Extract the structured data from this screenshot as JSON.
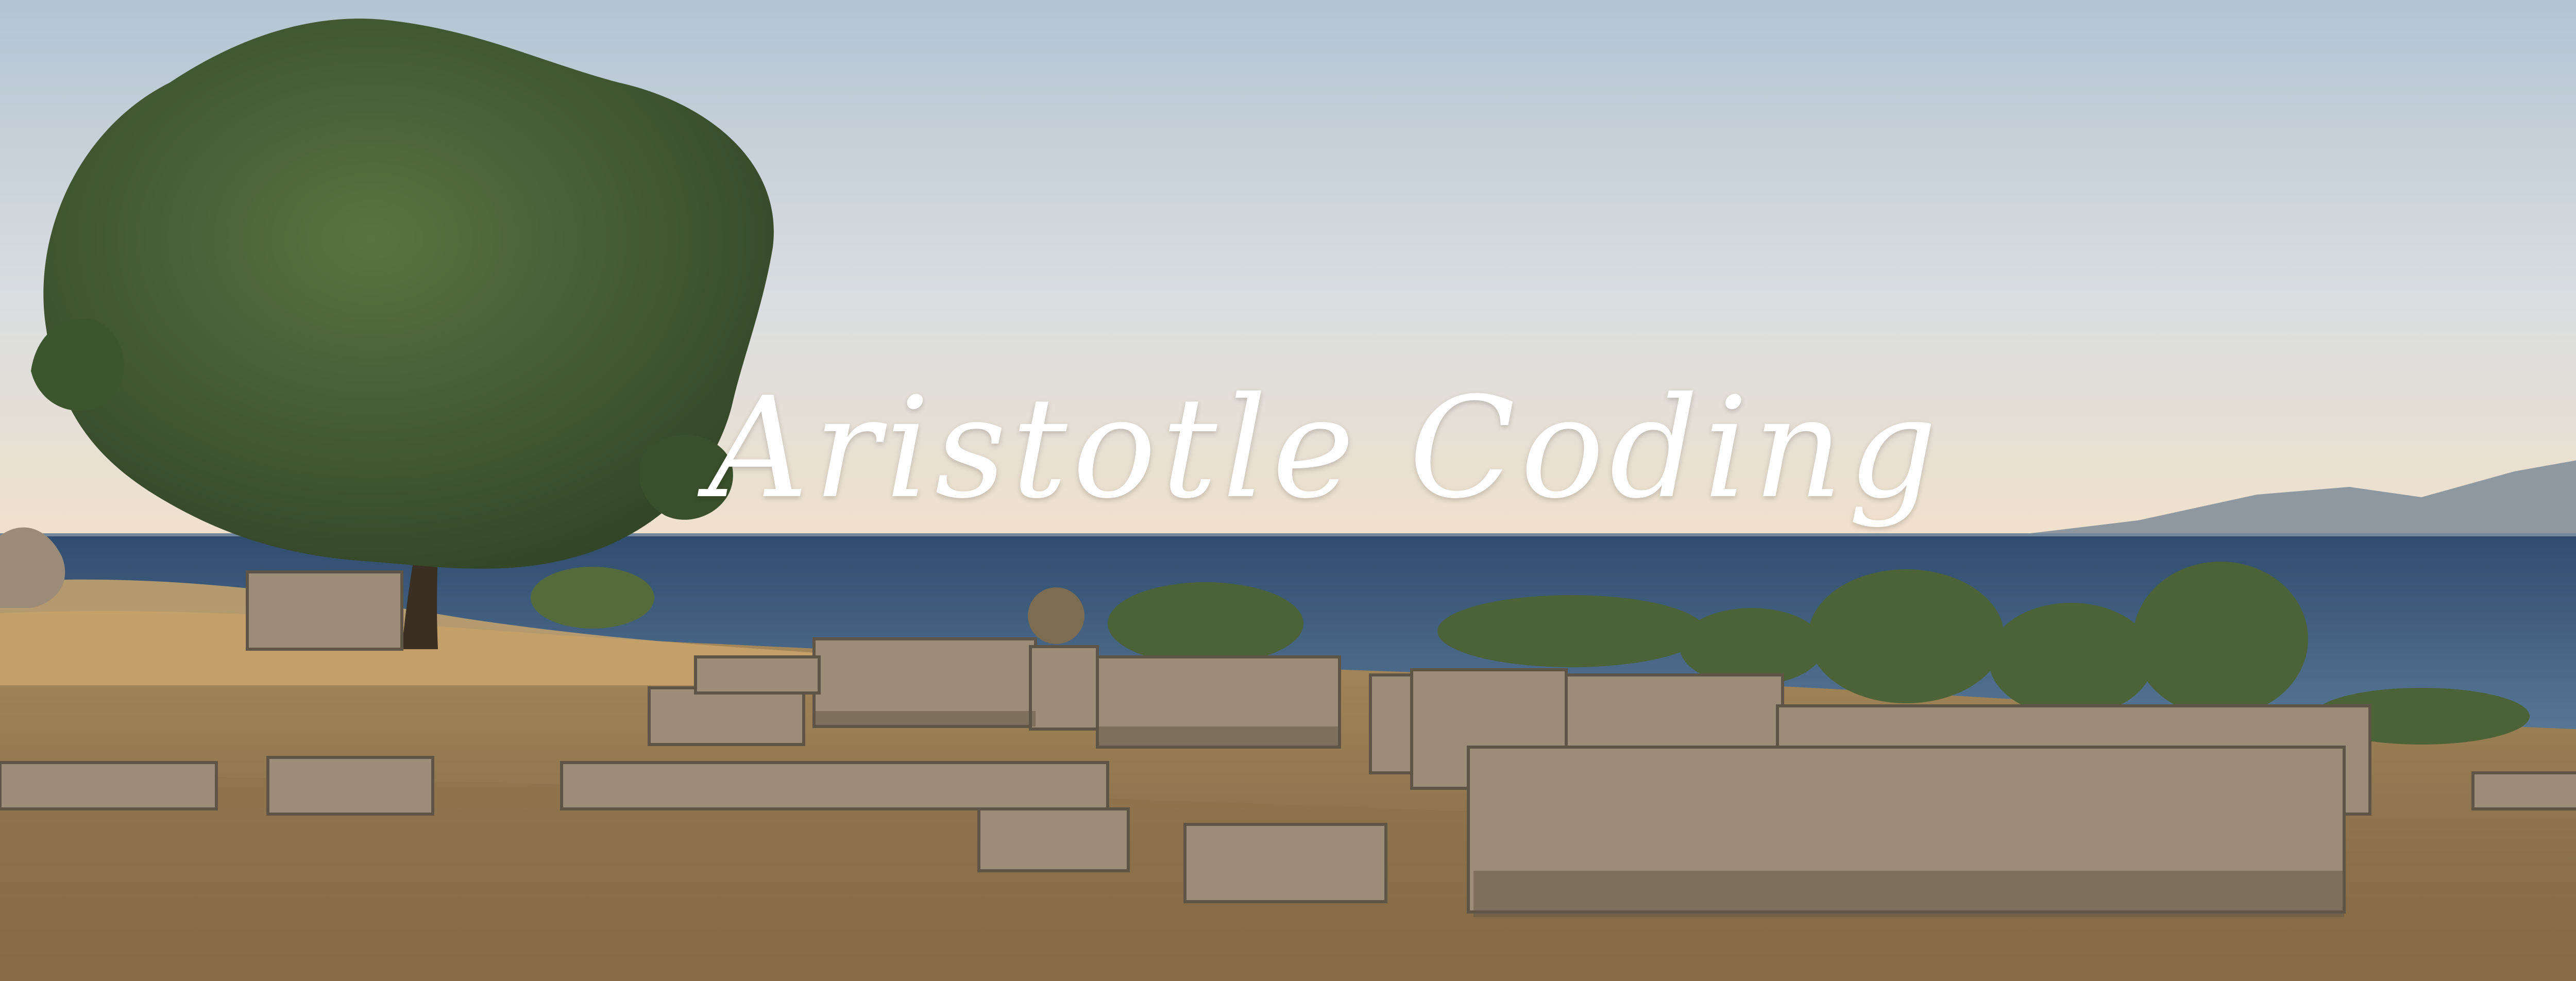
{
  "banner": {
    "title": "Aristotle Coding"
  },
  "scene": {
    "subject": "ancient ruins by the sea with an olive tree",
    "icons": [
      "tree-icon",
      "sea",
      "mountains",
      "stone-ruins"
    ],
    "colors": {
      "sky_top": "#b6c6d3",
      "sky_horizon": "#f1e2cf",
      "sea": "#3f5f80",
      "mountains": "#7a8797",
      "tree": "#3c5430",
      "ground": "#8b7551",
      "dry_grass": "#c9a56c",
      "stone": "#9b8d77",
      "stone_shadow": "#5f5546",
      "title_text": "#ffffff"
    }
  }
}
